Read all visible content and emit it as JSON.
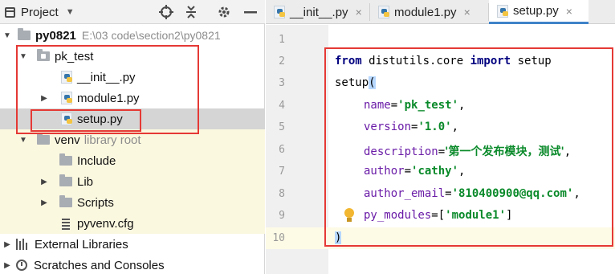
{
  "project_panel": {
    "title": "Project",
    "tree": {
      "root": {
        "name": "py0821",
        "path": "E:\\03 code\\section2\\py0821"
      },
      "pk_test": {
        "name": "pk_test",
        "files": [
          "__init__.py",
          "module1.py",
          "setup.py"
        ]
      },
      "venv": {
        "name": "venv",
        "note": "library root",
        "children": [
          "Include",
          "Lib",
          "Scripts",
          "pyvenv.cfg"
        ]
      },
      "external": "External Libraries",
      "scratches": "Scratches and Consoles"
    }
  },
  "tabs": [
    {
      "label": "__init__.py",
      "active": false
    },
    {
      "label": "module1.py",
      "active": false
    },
    {
      "label": "setup.py",
      "active": true
    }
  ],
  "editor": {
    "line_numbers": [
      "1",
      "2",
      "3",
      "4",
      "5",
      "6",
      "7",
      "8",
      "9",
      "10"
    ],
    "code": {
      "l2_from": "from",
      "l2_mod": " distutils.core ",
      "l2_import": "import",
      "l2_name": " setup",
      "l3_call": "setup",
      "l3_paren": "(",
      "l4_key": "name",
      "l4_val": "'pk_test'",
      "l5_key": "version",
      "l5_val": "'1.0'",
      "l6_key": "description",
      "l6_val": "'第一个发布模块，测试'",
      "l7_key": "author",
      "l7_val": "'cathy'",
      "l8_key": "author_email",
      "l8_val": "'810400900@qq.com'",
      "l9_key": "py_modules",
      "l9_open": "=[",
      "l9_val": "'module1'",
      "l9_close": "]",
      "l10_paren": ")"
    }
  },
  "colors": {
    "annotation_box": "#e53935",
    "keyword": "#00007f",
    "string": "#0a8a2a",
    "param": "#6a1ca7"
  }
}
